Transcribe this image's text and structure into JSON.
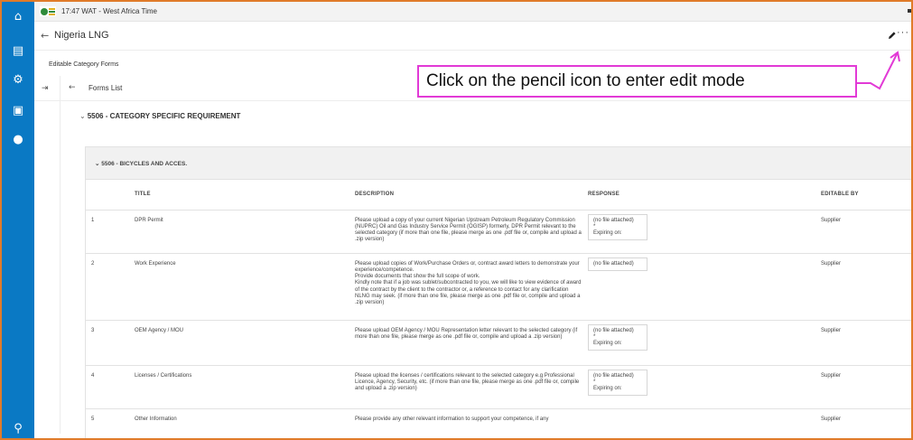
{
  "topbar": {
    "clock": "17:47 WAT - West Africa Time"
  },
  "header": {
    "back_glyph": "←",
    "title": "Nigeria LNG",
    "more_glyph": "···"
  },
  "sidebar": {
    "items": [
      {
        "icon": "home-icon",
        "glyph": "⌂"
      },
      {
        "icon": "dashboard-icon",
        "glyph": "▤"
      },
      {
        "icon": "user-settings-icon",
        "glyph": "⚙"
      },
      {
        "icon": "documents-icon",
        "glyph": "▣"
      },
      {
        "icon": "user-icon",
        "glyph": "●"
      },
      {
        "icon": "search-icon",
        "glyph": "⚲"
      }
    ]
  },
  "breadcrumb": "Editable Category Forms",
  "forms": {
    "collapse_glyph": "⇥",
    "back_glyph": "←",
    "label": "Forms List"
  },
  "section": {
    "chevron": "⌄",
    "title": "5506 - CATEGORY SPECIFIC REQUIREMENT"
  },
  "subsection": {
    "title": "⌄ 5506 - BICYCLES AND ACCES."
  },
  "table": {
    "headers": [
      "",
      "TITLE",
      "DESCRIPTION",
      "RESPONSE",
      "EDITABLE BY"
    ],
    "rows": [
      {
        "num": "1",
        "title": "DPR Permit",
        "description": "Please upload a copy of your current Nigerian Upstream Petroleum Regulatory Commission (NUPRC) Oil and Gas Industry Service Permit (OGISP) formerly, DPR Permit relevant to the selected category (if more than one file, please merge as one .pdf file or, compile and upload a .zip version)",
        "response": "(no file attached)",
        "required": "*",
        "expiring": "Expiring on:",
        "editable_by": "Supplier"
      },
      {
        "num": "2",
        "title": "Work Experience",
        "description": "Please upload copies of Work/Purchase Orders or, contract award letters to demonstrate your experience/competence.\nProvide documents that show the full scope of work.\nKindly note that if a job was sublet/subcontracted to you, we will like to view evidence of award of the contract by the client to the contractor or, a reference to contact for any clarification NLNG may seek. (if more than one file, please merge as one .pdf file or, compile and upload a .zip version)",
        "response": "(no file attached)",
        "required": "",
        "expiring": "",
        "editable_by": "Supplier"
      },
      {
        "num": "3",
        "title": "OEM Agency / MOU",
        "description": "Please upload OEM Agency / MOU Representation letter relevant to the selected category (if more than one file, please merge as one .pdf file or, compile and upload a .zip version)",
        "response": "(no file attached)",
        "required": "*",
        "expiring": "Expiring on:",
        "editable_by": "Supplier"
      },
      {
        "num": "4",
        "title": "Licenses / Certifications",
        "description": "Please upload the licenses / certifications relevant to the selected category e.g Professional Licence, Agency, Security, etc. (if more than one file, please merge as one .pdf file or, compile and upload a .zip version)",
        "response": "(no file attached)",
        "required": "*",
        "expiring": "Expiring on:",
        "editable_by": "Supplier"
      },
      {
        "num": "5",
        "title": "Other Information",
        "description": "Please provide any other relevant information to support your competence, if any",
        "response": "",
        "required": "",
        "expiring": "",
        "editable_by": "Supplier"
      }
    ]
  },
  "annotation": {
    "text": "Click on the pencil icon to enter edit mode"
  },
  "colors": {
    "sidebar": "#0a79c4",
    "annotation_border": "#e23ad6",
    "frame": "#e07b2a"
  }
}
